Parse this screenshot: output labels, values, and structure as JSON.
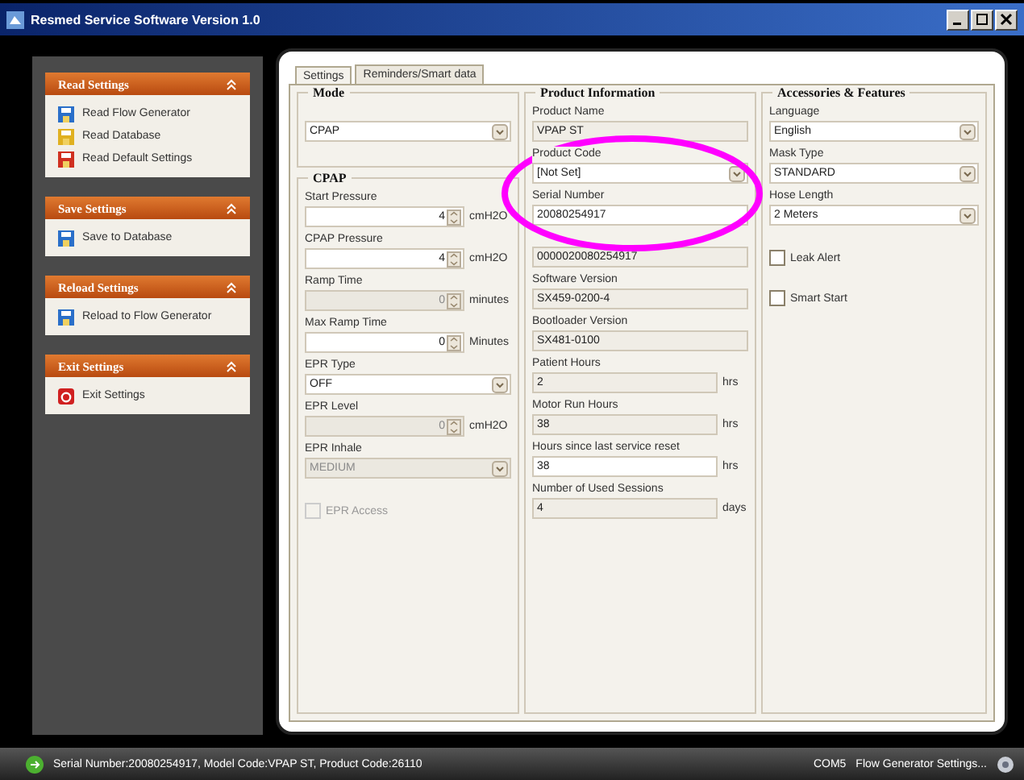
{
  "window": {
    "title": "Resmed Service Software Version 1.0"
  },
  "sidebar": {
    "sections": [
      {
        "title": "Read Settings",
        "items": [
          {
            "label": "Read Flow Generator",
            "kind": "read"
          },
          {
            "label": "Read Database",
            "kind": "database"
          },
          {
            "label": "Read Default Settings",
            "kind": "default"
          }
        ]
      },
      {
        "title": "Save Settings",
        "items": [
          {
            "label": "Save to Database",
            "kind": "save"
          }
        ]
      },
      {
        "title": "Reload Settings",
        "items": [
          {
            "label": "Reload to Flow Generator",
            "kind": "read"
          }
        ]
      },
      {
        "title": "Exit Settings",
        "items": [
          {
            "label": "Exit Settings",
            "kind": "exit"
          }
        ]
      }
    ]
  },
  "tabs": [
    {
      "label": "Settings",
      "selected": true
    },
    {
      "label": "Reminders/Smart data",
      "selected": false
    }
  ],
  "columns": [
    {
      "groups": [
        {
          "title": "Mode",
          "fields": [
            {
              "kind": "select",
              "value": "CPAP",
              "disabled": false
            }
          ]
        },
        {
          "title": "CPAP",
          "fields": [
            {
              "kind": "spin",
              "label": "Start Pressure",
              "value": "4",
              "unit": "cmH2O",
              "disabled": false
            },
            {
              "kind": "spin",
              "label": "CPAP Pressure",
              "value": "4",
              "unit": "cmH2O",
              "disabled": false
            },
            {
              "kind": "spin",
              "label": "Ramp Time",
              "value": "0",
              "unit": "minutes",
              "disabled": true
            },
            {
              "kind": "spin",
              "label": "Max Ramp Time",
              "value": "0",
              "unit": "Minutes",
              "disabled": false
            },
            {
              "kind": "select",
              "label": "EPR Type",
              "value": "OFF",
              "disabled": false
            },
            {
              "kind": "spin",
              "label": "EPR Level",
              "value": "0",
              "unit": "cmH2O",
              "disabled": true
            },
            {
              "kind": "select",
              "label": "EPR Inhale",
              "value": "MEDIUM",
              "disabled": true
            },
            {
              "kind": "check",
              "label": "EPR Access",
              "checked": false,
              "disabled": true
            }
          ]
        }
      ]
    },
    {
      "groups": [
        {
          "title": "Product Information",
          "fields": [
            {
              "kind": "text",
              "label": "Product Name",
              "value": "VPAP ST",
              "disabled": true
            },
            {
              "kind": "select",
              "label": "Product Code",
              "value": "[Not Set]",
              "disabled": false
            },
            {
              "kind": "text",
              "label": "Serial Number",
              "value": "20080254917",
              "disabled": false
            },
            {
              "kind": "text",
              "value": "0000020080254917",
              "disabled": true
            },
            {
              "kind": "text",
              "label": "Software Version",
              "value": "SX459-0200-4",
              "disabled": true
            },
            {
              "kind": "text",
              "label": "Bootloader Version",
              "value": "SX481-0100",
              "disabled": true
            },
            {
              "kind": "text",
              "label": "Patient Hours",
              "value": "2",
              "unit": "hrs",
              "disabled": true
            },
            {
              "kind": "text",
              "label": "Motor Run Hours",
              "value": "38",
              "unit": "hrs",
              "disabled": true
            },
            {
              "kind": "text",
              "label": "Hours since last service reset",
              "value": "38",
              "unit": "hrs",
              "disabled": false
            },
            {
              "kind": "text",
              "label": "Number of Used Sessions",
              "value": "4",
              "unit": "days",
              "disabled": true
            }
          ]
        }
      ]
    },
    {
      "groups": [
        {
          "title": "Accessories & Features",
          "fields": [
            {
              "kind": "select",
              "label": "Language",
              "value": "English",
              "disabled": false
            },
            {
              "kind": "select",
              "label": "Mask Type",
              "value": "STANDARD",
              "disabled": false
            },
            {
              "kind": "select",
              "label": "Hose Length",
              "value": "2 Meters",
              "disabled": false
            },
            {
              "kind": "check",
              "label": "Leak Alert",
              "checked": false,
              "disabled": false
            },
            {
              "kind": "check",
              "label": "Smart Start",
              "checked": false,
              "disabled": false
            }
          ]
        }
      ]
    }
  ],
  "status_bar": {
    "text": "Serial Number:20080254917, Model Code:VPAP ST, Product Code:26110",
    "port": "COM5",
    "mode": "Flow Generator Settings..."
  }
}
